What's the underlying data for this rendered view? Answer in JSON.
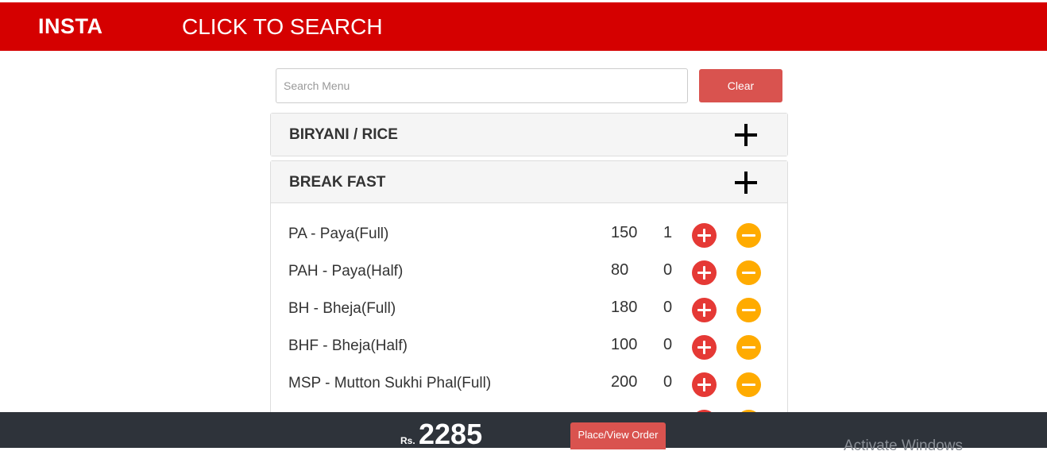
{
  "header": {
    "brand": "INSTA",
    "search_link": "CLICK TO SEARCH"
  },
  "search": {
    "placeholder": "Search Menu",
    "value": "",
    "clear_label": "Clear"
  },
  "categories": [
    {
      "title": "BIRYANI / RICE",
      "expanded": false
    },
    {
      "title": "BREAK FAST",
      "expanded": true
    }
  ],
  "items": [
    {
      "name": "PA - Paya(Full)",
      "price": "150",
      "qty": "1"
    },
    {
      "name": "PAH - Paya(Half)",
      "price": "80",
      "qty": "0"
    },
    {
      "name": "BH - Bheja(Full)",
      "price": "180",
      "qty": "0"
    },
    {
      "name": "BHF - Bheja(Half)",
      "price": "100",
      "qty": "0"
    },
    {
      "name": "MSP - Mutton Sukhi Phal(Full)",
      "price": "200",
      "qty": "0"
    }
  ],
  "footer": {
    "currency": "Rs.",
    "total": "2285",
    "order_label": "Place/View Order",
    "watermark": "Activate Windows"
  },
  "colors": {
    "header_bg": "#d50000",
    "add_button": "#e53935",
    "remove_button": "#ffab00",
    "footer_bg": "#2e333a",
    "danger_button": "#d9534f"
  }
}
